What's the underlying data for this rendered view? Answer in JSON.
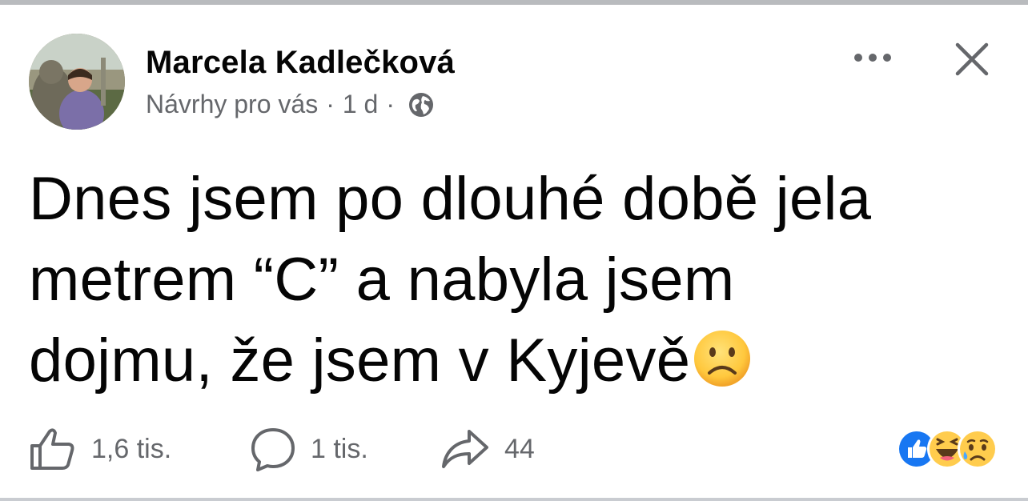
{
  "post": {
    "author": "Marcela Kadlečková",
    "meta": {
      "suggested": "Návrhy pro vás",
      "separator": "·",
      "time": "1 d",
      "audience_icon": "globe-icon"
    },
    "text_lines": [
      "Dnes jsem po dlouhé době jela",
      "metrem “C” a nabyla jsem",
      "dojmu, že jsem v Kyjevě"
    ],
    "text_emoji": "frowning-face-emoji"
  },
  "footer": {
    "like_count": "1,6 tis.",
    "comment_count": "1 tis.",
    "share_count": "44",
    "reaction_icons": [
      "like-reaction-icon",
      "haha-reaction-icon",
      "sad-reaction-icon"
    ]
  },
  "colors": {
    "text": "#050505",
    "secondary": "#65676b",
    "like_blue": "#1877f2",
    "emoji_yellow": "#ffcc4d"
  }
}
